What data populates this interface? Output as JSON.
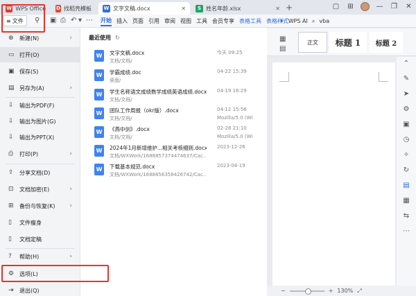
{
  "title_bar": {
    "tabs": [
      {
        "label": "WPS Office",
        "icon": "wps-logo-icon"
      },
      {
        "label": "找稻壳模板",
        "icon": "template-icon"
      },
      {
        "label": "文字文稿.docx",
        "icon": "word-doc-icon",
        "active": true
      },
      {
        "label": "姓名年龄.xlsx",
        "icon": "excel-icon"
      }
    ]
  },
  "menu_bar": {
    "file_label": "文件",
    "items": [
      "开始",
      "插入",
      "页面",
      "引用",
      "审阅",
      "视图",
      "工具",
      "会员专享",
      "表格工具",
      "表格样式"
    ],
    "wps_ai": "WPS AI",
    "search": "vba"
  },
  "ribbon": {
    "styles": [
      "正文",
      "标题 1",
      "标题 2"
    ]
  },
  "file_menu": {
    "items": [
      {
        "label": "新建(N)",
        "icon": "new-icon",
        "arrow": true
      },
      {
        "label": "打开(O)",
        "icon": "open-folder-icon",
        "arrow": false,
        "selected": true
      },
      {
        "label": "保存(S)",
        "icon": "save-icon",
        "arrow": false
      },
      {
        "label": "另存为(A)",
        "icon": "save-as-icon",
        "arrow": true
      },
      {
        "label": "输出为PDF(F)",
        "icon": "export-pdf-icon",
        "arrow": false
      },
      {
        "label": "输出为图片(G)",
        "icon": "export-image-icon",
        "arrow": false
      },
      {
        "label": "输出为PPT(X)",
        "icon": "export-ppt-icon",
        "arrow": false
      },
      {
        "label": "打印(P)",
        "icon": "print-icon",
        "arrow": true
      },
      {
        "label": "分享文档(D)",
        "icon": "share-icon",
        "arrow": false
      },
      {
        "label": "文档加密(E)",
        "icon": "lock-icon",
        "arrow": true
      },
      {
        "label": "备份与恢复(K)",
        "icon": "backup-icon",
        "arrow": true
      },
      {
        "label": "文件瘦身",
        "icon": "slim-icon",
        "arrow": false
      },
      {
        "label": "文档定稿",
        "icon": "finalize-icon",
        "arrow": false
      },
      {
        "label": "帮助(H)",
        "icon": "help-icon",
        "arrow": true
      },
      {
        "label": "选项(L)",
        "icon": "settings-icon",
        "arrow": false
      },
      {
        "label": "退出(Q)",
        "icon": "exit-icon",
        "arrow": false
      }
    ]
  },
  "recent": {
    "title": "最近使用",
    "files": [
      {
        "name": "文字文稿.docx",
        "path": "文档/文档/",
        "date": "今天 09:25",
        "location": ""
      },
      {
        "name": "学霸成绩.doc",
        "path": "桌面/",
        "date": "04-22 15:39",
        "location": ""
      },
      {
        "name": "学生名称语文成绩数学成绩英语成绩.docx",
        "path": "文档/文档/",
        "date": "04-19 16:29",
        "location": ""
      },
      {
        "name": "团队工作周报（okr版）.docx",
        "path": "文档/文档/",
        "date": "04-12 15:56",
        "location": "Mozilla/5.0 (Wi"
      },
      {
        "name": "《燕中剑》.docx",
        "path": "文档/文档/",
        "date": "02-28 21:10",
        "location": "Mozilla/5.0 (Wi"
      },
      {
        "name": "2024年1月新增维护...相关考核细则.docx",
        "path": "文档/WXWork/1688857374474637/Cac...",
        "date": "2023-12-26",
        "location": ""
      },
      {
        "name": "下载基本规范.docx",
        "path": "文档/WXWork/1688856358426742/Cac...",
        "date": "2023-04-19",
        "location": ""
      }
    ]
  },
  "status_bar": {
    "zoom": "130%"
  }
}
